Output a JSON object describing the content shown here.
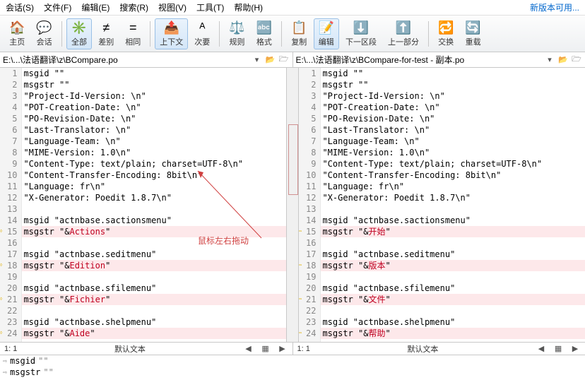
{
  "menu": {
    "session": "会话(S)",
    "file": "文件(F)",
    "edit": "编辑(E)",
    "search": "搜索(R)",
    "view": "视图(V)",
    "tools": "工具(T)",
    "help": "帮助(H)",
    "newver": "新版本可用..."
  },
  "toolbar": {
    "home": "主页",
    "sessions": "会话",
    "all": "全部",
    "diff": "差别",
    "same": "相同",
    "context": "上下文",
    "minor": "次要",
    "rules": "规则",
    "format": "格式",
    "copy": "复制",
    "editbtn": "编辑",
    "nextsec": "下一区段",
    "prevsec": "上一部分",
    "swap": "交换",
    "reload": "重载"
  },
  "paths": {
    "left": "E:\\...\\法语翻译\\z\\BCompare.po",
    "right": "E:\\...\\法语翻译\\z\\BCompare-for-test - 副本.po"
  },
  "common_lines": [
    "msgid \"\"",
    "msgstr \"\"",
    "\"Project-Id-Version: \\n\"",
    "\"POT-Creation-Date: \\n\"",
    "\"PO-Revision-Date: \\n\"",
    "\"Last-Translator: \\n\"",
    "\"Language-Team: \\n\"",
    "\"MIME-Version: 1.0\\n\"",
    "\"Content-Type: text/plain; charset=UTF-8\\n\"",
    "\"Content-Transfer-Encoding: 8bit\\n\"",
    "\"Language: fr\\n\"",
    "\"X-Generator: Poedit 1.8.7\\n\"",
    ""
  ],
  "groups": [
    {
      "id": "msgid \"actnbase.sactionsmenu\"",
      "left": "Actions",
      "right": "开始"
    },
    {
      "id": "msgid \"actnbase.seditmenu\"",
      "left": "Edition",
      "right": "版本"
    },
    {
      "id": "msgid \"actnbase.sfilemenu\"",
      "left": "Fichier",
      "right": "文件"
    },
    {
      "id": "msgid \"actnbase.shelpmenu\"",
      "left": "Aide",
      "right": "帮助"
    }
  ],
  "msgstr_prefix": "msgstr \"&",
  "msgstr_suffix": "\"",
  "annotation": "鼠标左右拖动",
  "status": {
    "pos": "1: 1",
    "mode": "默认文本"
  },
  "bottom": {
    "k1": "msgid",
    "v1": "\"\"",
    "k2": "msgstr",
    "v2": "\"\""
  }
}
